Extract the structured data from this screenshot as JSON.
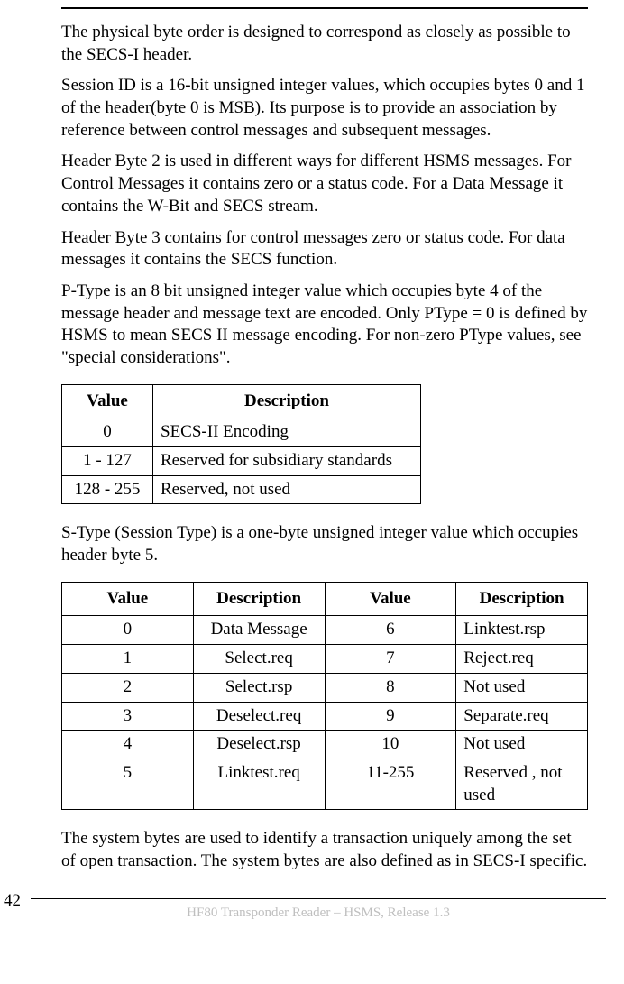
{
  "paragraphs": {
    "p1": "The physical byte order is designed to correspond as closely as possible to the SECS-I header.",
    "p2": "Session ID is a 16-bit unsigned integer values, which occupies bytes 0 and 1 of the header(byte 0 is MSB). Its purpose is to provide an association by reference between control messages and subsequent messages.",
    "p3": "Header Byte 2 is used in different ways for different HSMS messages. For Control Messages it contains zero or a status code. For a Data Message it contains the W-Bit and SECS stream.",
    "p4": "Header Byte 3 contains for control messages zero or status code. For data messages it contains the SECS function.",
    "p5": "P-Type is an 8 bit unsigned integer value which occupies byte 4 of the message header and message text are encoded. Only PType = 0 is defined by HSMS to mean SECS II message encoding. For non-zero PType values, see \"special considerations\".",
    "p6": "S-Type (Session Type) is a one-byte unsigned integer value which occupies header byte 5.",
    "p7": "The system bytes are used to identify a transaction uniquely among the set of open transaction. The system bytes are also defined as in SECS-I specific."
  },
  "table1": {
    "headers": {
      "h1": "Value",
      "h2": "Description"
    },
    "rows": [
      {
        "v": "0",
        "d": "SECS-II Encoding"
      },
      {
        "v": "1 - 127",
        "d": "Reserved for subsidiary standards"
      },
      {
        "v": "128 - 255",
        "d": "Reserved, not used"
      }
    ]
  },
  "table2": {
    "headers": {
      "h1": "Value",
      "h2": "Description",
      "h3": "Value",
      "h4": "Description"
    },
    "rows": [
      {
        "v1": "0",
        "d1": "Data Message",
        "v2": "6",
        "d2": "Linktest.rsp"
      },
      {
        "v1": "1",
        "d1": "Select.req",
        "v2": "7",
        "d2": "Reject.req"
      },
      {
        "v1": "2",
        "d1": "Select.rsp",
        "v2": "8",
        "d2": "Not used"
      },
      {
        "v1": "3",
        "d1": "Deselect.req",
        "v2": "9",
        "d2": "Separate.req"
      },
      {
        "v1": "4",
        "d1": "Deselect.rsp",
        "v2": "10",
        "d2": "Not used"
      },
      {
        "v1": "5",
        "d1": "Linktest.req",
        "v2": "11-255",
        "d2": "Reserved , not used"
      }
    ]
  },
  "footer": {
    "page": "42",
    "text": "HF80 Transponder Reader – HSMS, Release 1.3"
  }
}
